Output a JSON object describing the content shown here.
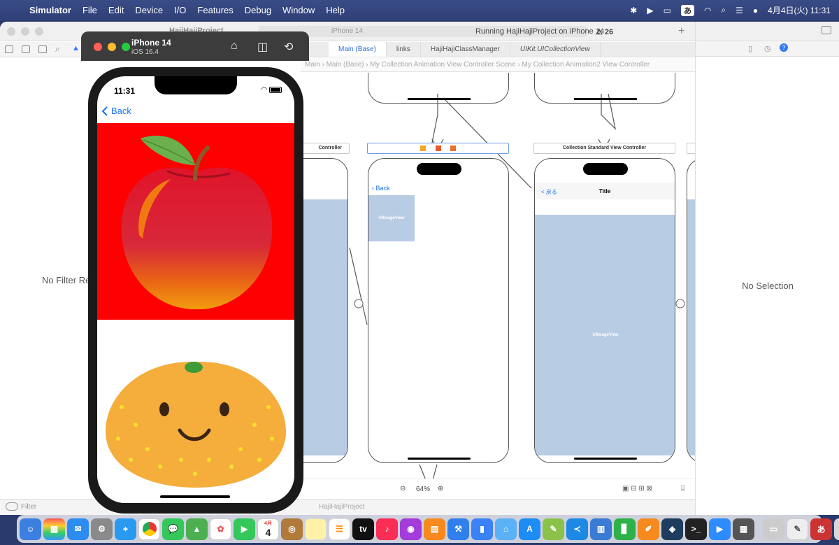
{
  "menubar": {
    "app_name": "Simulator",
    "items": [
      "File",
      "Edit",
      "Device",
      "I/O",
      "Features",
      "Debug",
      "Window",
      "Help"
    ],
    "ime": "あ",
    "clock": "4月4日(火)  11:31"
  },
  "xcode": {
    "project_title": "HajiHajiProject",
    "scheme_device": "iPhone 14",
    "run_status": "Running HajiHajiProject on iPhone 14",
    "warning_count": "26",
    "tabs": [
      "Main (Base)",
      "links",
      "HajiHajiClassManager",
      "UIKit.UICollectionView"
    ],
    "jumpbar": [
      "Main",
      "Main (Base)",
      "My Collection Animation View Controller Scene",
      "My Collection Animation2 View Controller"
    ],
    "left_panel_message": "No Filter Re",
    "filter_placeholder": "Filter",
    "bottom_project": "HajiHajiProject",
    "zoom_level": "64%"
  },
  "storyboard": {
    "scene1_title": "Controller",
    "scene2_back": "Back",
    "scene2_image": "UIImageView",
    "scene3_title_bar": "Collection Standard View Controller",
    "scene3_back": "< 戻る",
    "scene3_nav_title": "Title",
    "scene3_image": "UIImageView"
  },
  "inspector": {
    "message": "No Selection"
  },
  "simulator": {
    "device_name": "iPhone 14",
    "os_version": "iOS 16.4",
    "status_time": "11:31",
    "back_label": "Back"
  },
  "dock": {
    "calendar_month": "4月",
    "calendar_day": "4"
  }
}
